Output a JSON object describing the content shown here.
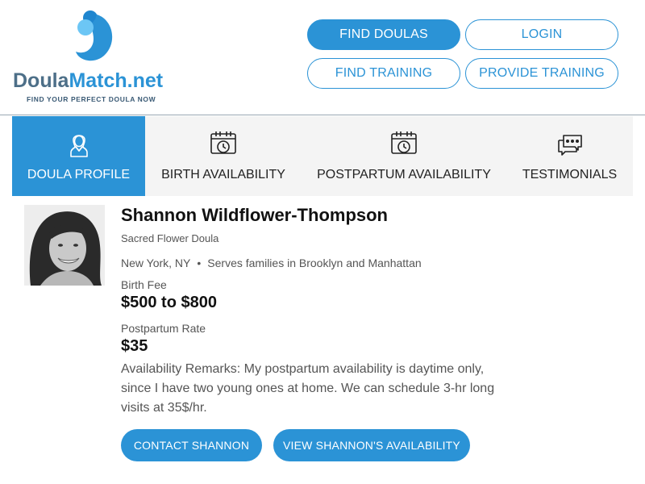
{
  "brand": {
    "name_part1": "Doula",
    "name_part2": "Match.net",
    "tagline": "FIND YOUR PERFECT DOULA NOW",
    "logo_icon": "drop-circle-logo-icon",
    "colors": {
      "primary": "#2b93d6",
      "light": "#5bbcf2",
      "dark_text": "#4d6f88"
    }
  },
  "nav": {
    "find_doulas": "FIND DOULAS",
    "login": "LOGIN",
    "find_training": "FIND TRAINING",
    "provide_training": "PROVIDE TRAINING"
  },
  "tabs": [
    {
      "label": "DOULA PROFILE",
      "icon": "doula-person-icon",
      "active": true
    },
    {
      "label": "BIRTH AVAILABILITY",
      "icon": "calendar-clock-icon",
      "active": false
    },
    {
      "label": "POSTPARTUM AVAILABILITY",
      "icon": "calendar-clock-icon",
      "active": false
    },
    {
      "label": "TESTIMONIALS",
      "icon": "chat-bubbles-icon",
      "active": false
    }
  ],
  "profile": {
    "name": "Shannon Wildflower-Thompson",
    "business": "Sacred Flower Doula",
    "city": "New York, NY",
    "service_area": "Serves families in Brooklyn and Manhattan",
    "birth_fee_label": "Birth Fee",
    "birth_fee": "$500 to $800",
    "postpartum_label": "Postpartum Rate",
    "postpartum_rate": "$35",
    "remarks": "Availability Remarks: My postpartum availability is daytime only, since I have two young ones at home. We can schedule 3-hr long visits at 35$/hr."
  },
  "actions": {
    "contact": "CONTACT SHANNON",
    "view_availability": "VIEW SHANNON'S AVAILABILITY"
  }
}
